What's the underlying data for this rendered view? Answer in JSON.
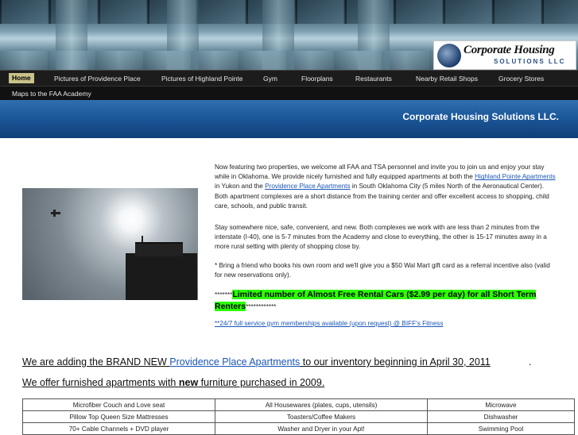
{
  "logo": {
    "title": "Corporate Housing",
    "subtitle": "SOLUTIONS LLC"
  },
  "nav": {
    "items": [
      {
        "label": "Home",
        "active": true
      },
      {
        "label": "Pictures of Providence Place"
      },
      {
        "label": "Pictures of Highland Pointe"
      },
      {
        "label": "Gym"
      },
      {
        "label": "Floorplans"
      },
      {
        "label": "Restaurants"
      },
      {
        "label": "Nearby Retail Shops"
      },
      {
        "label": "Grocery Stores"
      }
    ],
    "row2": [
      {
        "label": "Maps to the FAA Academy"
      }
    ]
  },
  "banner": {
    "title": "Corporate Housing Solutions LLC."
  },
  "intro": {
    "p1_a": "Now featuring two properties, we welcome all FAA and TSA personnel and invite you to join us and enjoy your stay while in Oklahoma.  We provide nicely furnished and fully equipped apartments at both the ",
    "link_highland": "Highland Pointe Apartments",
    "p1_b": " in Yukon and the ",
    "link_providence": "Providence Place Apartments",
    "p1_c": " in South Oklahoma City (5 miles North of the Aeronautical Center). Both apartment complexes are a short distance from the training center and offer excellent access to shopping, child care, schools, and public transit.",
    "p2": "Stay somewhere nice, safe, convenient, and new. Both complexes we work with are less than 2 minutes from the interstate (I-40), one is 5-7 minutes from the Academy and close to everything, the other is 15-17 minutes away in a more rural setting with plenty of shopping close by.",
    "p3": "* Bring a friend who books his own room and we'll give you a $50 Wal Mart gift card as a referral incentive also (valid for new reservations only).",
    "promo_prefix": "*******",
    "promo": "Limited number of Almost Free Rental Cars ($2.99 per day) for all Short Term Renters",
    "promo_suffix": "************",
    "gym_link": "**24/7 full service gym memberships available (upon request) @ BIFF's Fitness"
  },
  "headline1": {
    "a": "We are adding the BRAND NEW ",
    "link": "Providence Place Apartments",
    "b": " to our inventory beginning in April 30, 2011",
    "c": "."
  },
  "headline2": {
    "a": "We offer furnished apartments with ",
    "bold": "new",
    "b": " furniture purchased in 2009."
  },
  "amenities": [
    [
      "Microfiber Couch and Love seat",
      "All Housewares (plates, cups, utensils)",
      "Microwave"
    ],
    [
      "Pillow Top Queen Size Mattresses",
      "Toasters/Coffee Makers",
      "Dishwasher"
    ],
    [
      "70+ Cable Channels + DVD player",
      "Washer and Dryer in your Apt!",
      "Swimming Pool"
    ]
  ]
}
